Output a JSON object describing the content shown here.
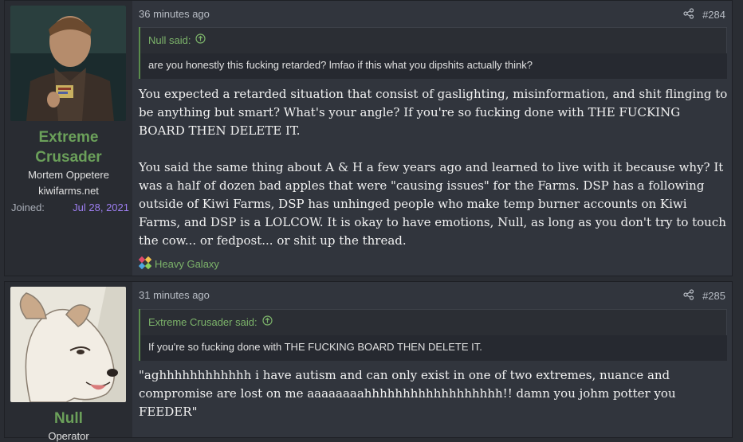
{
  "posts": [
    {
      "user": {
        "name_line1": "Extreme",
        "name_line2": "Crusader",
        "title": "Mortem Oppetere",
        "site": "kiwifarms.net",
        "joined_label": "Joined:",
        "joined_date": "Jul 28, 2021"
      },
      "time": "36 minutes ago",
      "number": "#284",
      "quote": {
        "author": "Null said:",
        "text": "are you honestly this fucking retarded? lmfao if this what you dipshits actually think?"
      },
      "paragraphs": [
        "You expected a retarded situation that consist of gaslighting, misinformation, and shit flinging to be anything but smart? What's your angle? If you're so fucking done with THE FUCKING BOARD THEN DELETE IT.",
        "You said the same thing about A & H a few years ago and learned to live with it because why? It was a half of dozen bad apples that were \"causing issues\" for the Farms. DSP has a following outside of Kiwi Farms, DSP has unhinged people who make temp burner accounts on Kiwi Farms, and DSP is a LOLCOW. It is okay to have emotions, Null, as long as you don't try to touch the cow... or fedpost... or shit up the thread."
      ],
      "reaction": "Heavy Galaxy"
    },
    {
      "user": {
        "name": "Null",
        "title": "Operator"
      },
      "time": "31 minutes ago",
      "number": "#285",
      "quote": {
        "author": "Extreme Crusader said:",
        "text": "If you're so fucking done with THE FUCKING BOARD THEN DELETE IT."
      },
      "paragraphs": [
        "\"aghhhhhhhhhhhh i have autism and can only exist in one of two extremes, nuance and compromise are lost on me aaaaaaaahhhhhhhhhhhhhhhhhh!! damn you johm potter you FEEDER\""
      ]
    }
  ],
  "icons": {
    "share": "share-icon",
    "quote_arrow": "arrow-up-circle-icon",
    "reaction": "pinwheel-icon"
  },
  "colors": {
    "username": "#6ba05a",
    "quote_accent": "#5a8c4c",
    "joined_date": "#9d7ef0"
  }
}
